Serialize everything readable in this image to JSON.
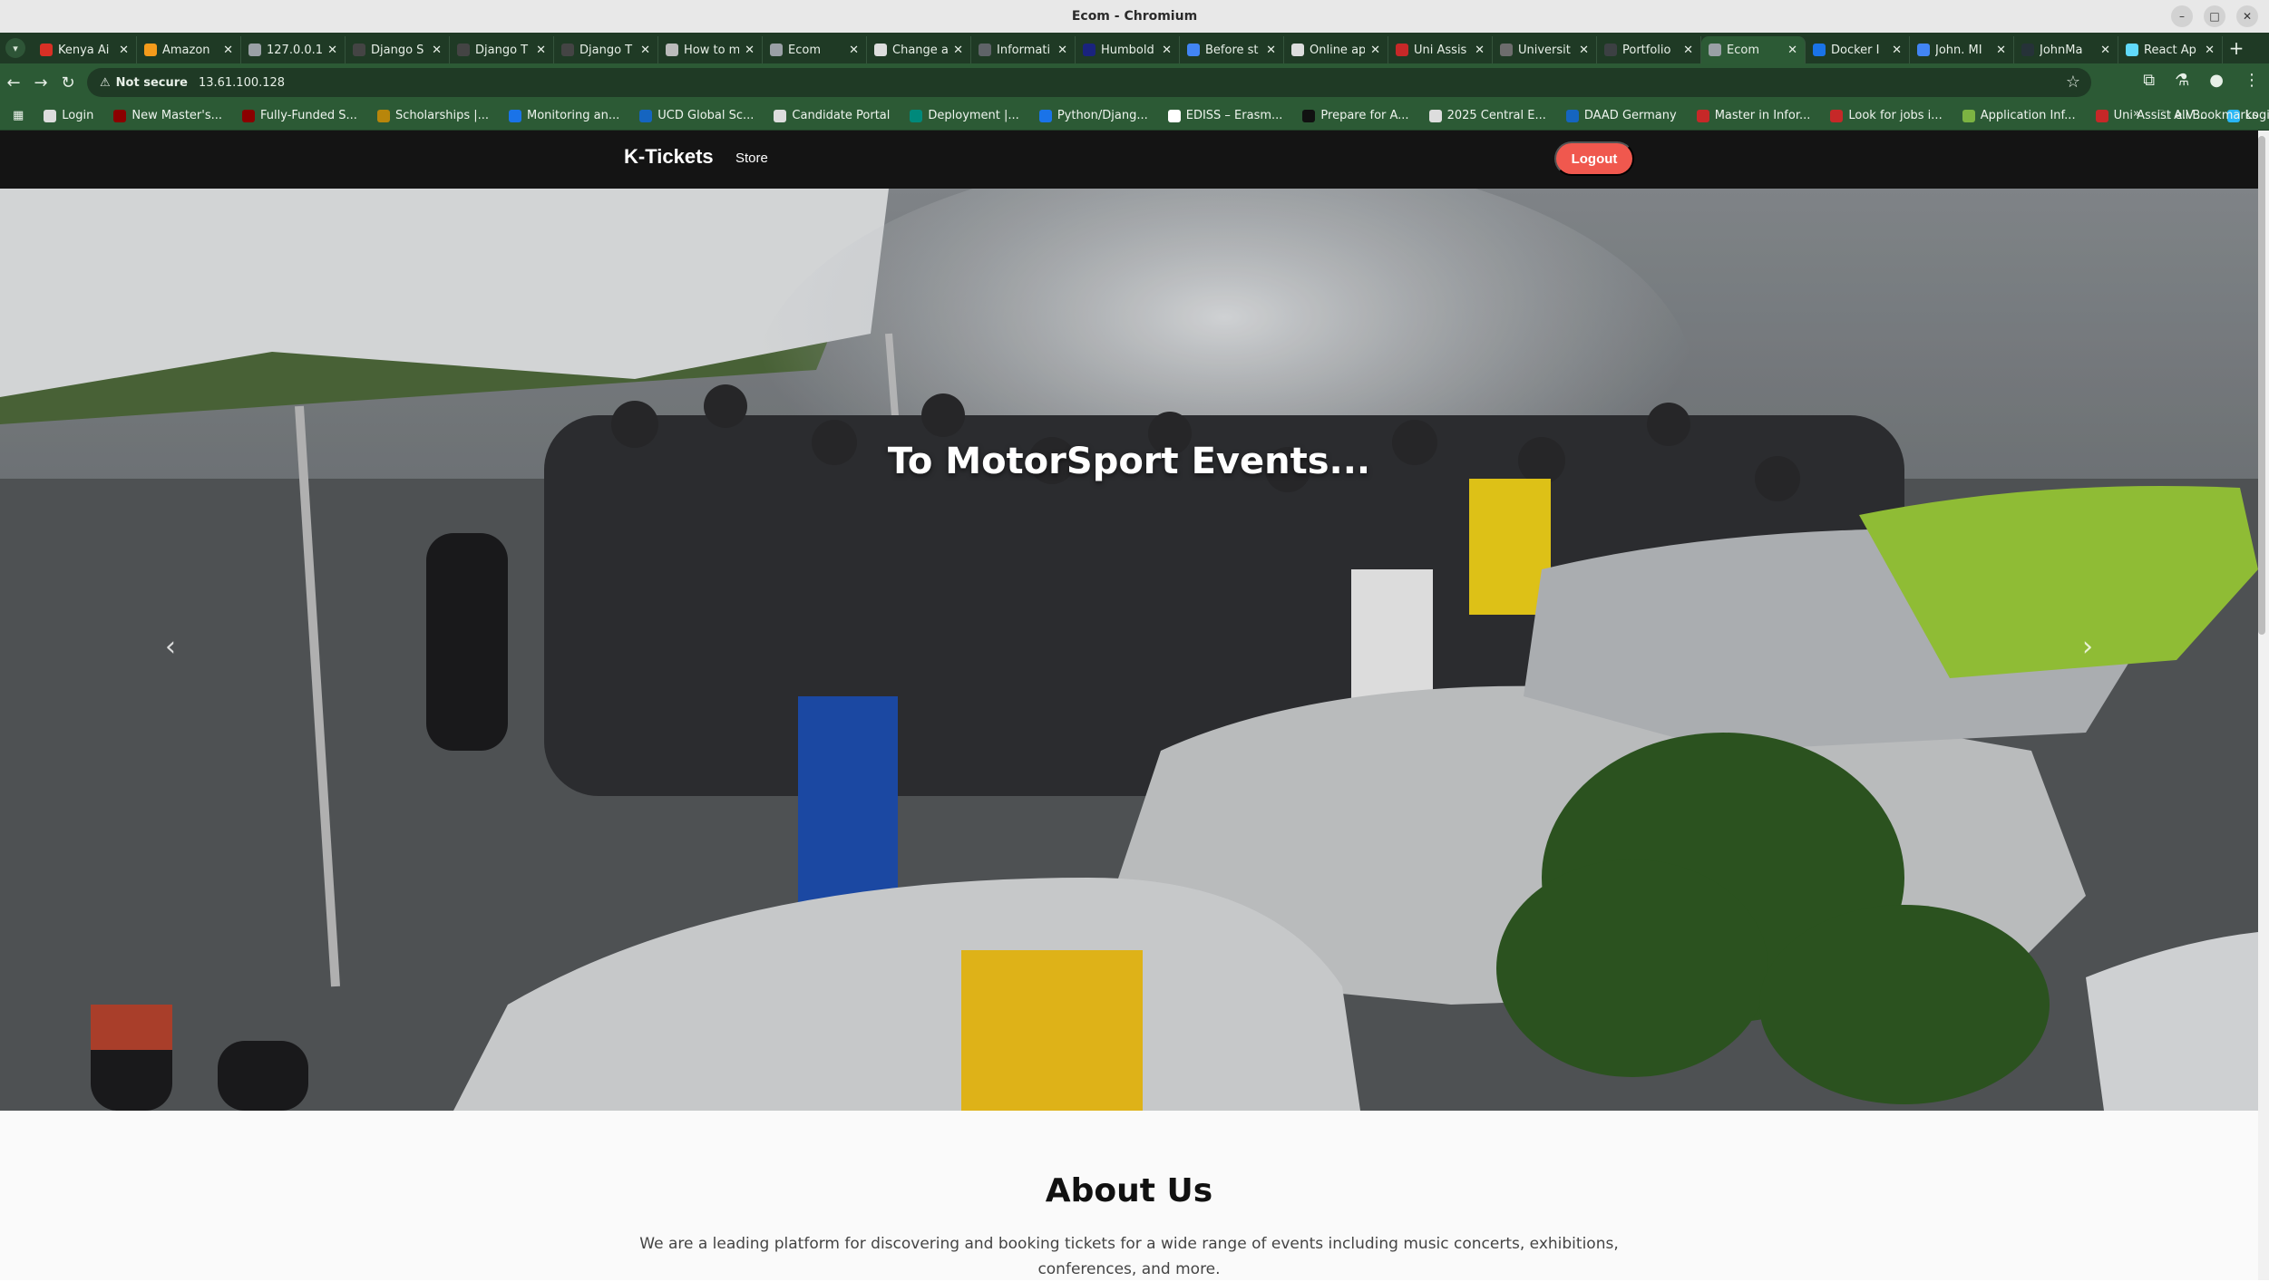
{
  "window": {
    "title": "Ecom - Chromium"
  },
  "tabs": [
    {
      "label": "Kenya Ai",
      "color": "#d93025"
    },
    {
      "label": "Amazon",
      "color": "#f59b1b"
    },
    {
      "label": "127.0.0.1",
      "color": "#9aa0a6"
    },
    {
      "label": "Django S",
      "color": "#444444"
    },
    {
      "label": "Django T",
      "color": "#444444"
    },
    {
      "label": "Django T",
      "color": "#444444"
    },
    {
      "label": "How to m",
      "color": "#bbbbbb"
    },
    {
      "label": "Ecom",
      "color": "#9aa0a6"
    },
    {
      "label": "Change a",
      "color": "#dddddd"
    },
    {
      "label": "Informati",
      "color": "#5f6368"
    },
    {
      "label": "Humbold",
      "color": "#1a237e"
    },
    {
      "label": "Before st",
      "color": "#4285f4"
    },
    {
      "label": "Online ap",
      "color": "#dddddd"
    },
    {
      "label": "Uni Assis",
      "color": "#c62828"
    },
    {
      "label": "Universit",
      "color": "#6d6d6d"
    },
    {
      "label": "Portfolio",
      "color": "#3c4043"
    },
    {
      "label": "Ecom",
      "color": "#9aa0a6",
      "active": true
    },
    {
      "label": "Docker I",
      "color": "#1a73e8"
    },
    {
      "label": "John. MI",
      "color": "#4285f4"
    },
    {
      "label": "JohnMa",
      "color": "#263238"
    },
    {
      "label": "React Ap",
      "color": "#61dafb"
    }
  ],
  "address": {
    "security": "Not secure",
    "url": "13.61.100.128"
  },
  "bookmarks": [
    {
      "label": "Login",
      "color": "#dddddd"
    },
    {
      "label": "New Master's...",
      "color": "#8b0000"
    },
    {
      "label": "Fully-Funded S...",
      "color": "#8b0000"
    },
    {
      "label": "Scholarships |...",
      "color": "#b8860b"
    },
    {
      "label": "Monitoring an...",
      "color": "#1a73e8"
    },
    {
      "label": "UCD Global Sc...",
      "color": "#1565c0"
    },
    {
      "label": "Candidate Portal",
      "color": "#dddddd"
    },
    {
      "label": "Deployment |...",
      "color": "#00897b"
    },
    {
      "label": "Python/Djang...",
      "color": "#1a73e8"
    },
    {
      "label": "EDISS – Erasm...",
      "color": "#ffffff"
    },
    {
      "label": "Prepare for A...",
      "color": "#111111"
    },
    {
      "label": "2025 Central E...",
      "color": "#dddddd"
    },
    {
      "label": "DAAD Germany",
      "color": "#1565c0"
    },
    {
      "label": "Master in Infor...",
      "color": "#c62828"
    },
    {
      "label": "Look for jobs i...",
      "color": "#c62828"
    },
    {
      "label": "Application Inf...",
      "color": "#7cb342"
    },
    {
      "label": "Uni Assist e.V....",
      "color": "#c62828"
    },
    {
      "label": "Login",
      "color": "#29b6f6"
    }
  ],
  "bookmarks_overflow": "»",
  "all_bookmarks": "All Bookmarks",
  "site": {
    "brand": "K-Tickets",
    "nav_store": "Store",
    "logout": "Logout"
  },
  "hero": {
    "caption": "To MotorSport Events...",
    "prev": "‹",
    "next": "›"
  },
  "about": {
    "heading": "About Us",
    "text": "We are a leading platform for discovering and booking tickets for a wide range of events including music concerts, exhibitions, conferences, and more."
  },
  "colors": {
    "browser_dark": "#1f3a25",
    "browser_mid": "#2c5a35",
    "site_nav": "#141414",
    "accent": "#f0584e"
  }
}
